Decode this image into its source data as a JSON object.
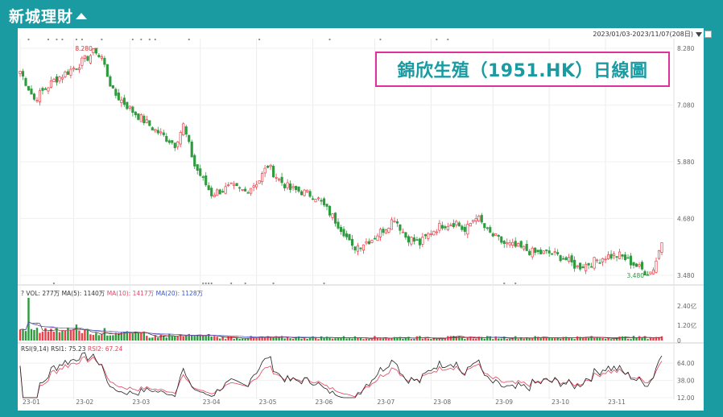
{
  "brand": {
    "name": "新城理財"
  },
  "header": {
    "date_range": "2023/01/03-2023/11/07(208日)"
  },
  "title": "錦欣生殖（1951.HK）日線圖",
  "colors": {
    "up": "#e8424b",
    "down": "#2e9b3f",
    "ma5": "#333333",
    "ma10": "#e04a6a",
    "ma20": "#3a55c8",
    "rsi1": "#222222",
    "rsi2": "#e6405a",
    "accent": "#1a9aa1",
    "title_border": "#e0309a"
  },
  "chart_data": [
    {
      "type": "candlestick",
      "name": "price",
      "x_tick_labels": [
        "23-01",
        "23-02",
        "23-03",
        "23-04",
        "23-05",
        "23-06",
        "23-07",
        "23-08",
        "23-09",
        "23-10",
        "23-11"
      ],
      "y_tick_labels": [
        "8.280",
        "7.080",
        "5.880",
        "4.680",
        "3.480"
      ],
      "ylim": [
        3.48,
        8.28
      ],
      "annotations": [
        {
          "text": "8.280",
          "kind": "high"
        },
        {
          "text": "3.480",
          "kind": "low"
        }
      ],
      "close_path": [
        [
          0,
          7.8
        ],
        [
          5,
          7.2
        ],
        [
          12,
          7.6
        ],
        [
          20,
          7.9
        ],
        [
          28,
          8.28
        ],
        [
          33,
          7.35
        ],
        [
          40,
          6.95
        ],
        [
          48,
          6.55
        ],
        [
          55,
          6.25
        ],
        [
          58,
          6.65
        ],
        [
          62,
          5.8
        ],
        [
          68,
          5.2
        ],
        [
          75,
          5.35
        ],
        [
          80,
          5.25
        ],
        [
          85,
          5.5
        ],
        [
          88,
          5.8
        ],
        [
          92,
          5.5
        ],
        [
          96,
          5.3
        ],
        [
          100,
          5.25
        ],
        [
          105,
          5.15
        ],
        [
          110,
          4.8
        ],
        [
          115,
          4.4
        ],
        [
          118,
          4.05
        ],
        [
          125,
          4.25
        ],
        [
          130,
          4.5
        ],
        [
          133,
          4.7
        ],
        [
          137,
          4.3
        ],
        [
          142,
          4.15
        ],
        [
          146,
          4.4
        ],
        [
          150,
          4.55
        ],
        [
          155,
          4.6
        ],
        [
          158,
          4.4
        ],
        [
          162,
          4.75
        ],
        [
          166,
          4.4
        ],
        [
          172,
          4.15
        ],
        [
          178,
          4.05
        ],
        [
          183,
          3.95
        ],
        [
          188,
          3.95
        ],
        [
          193,
          3.85
        ],
        [
          198,
          3.65
        ],
        [
          203,
          3.75
        ],
        [
          208,
          3.88
        ],
        [
          213,
          3.9
        ],
        [
          218,
          3.72
        ],
        [
          221,
          3.6
        ],
        [
          224,
          3.48
        ],
        [
          226,
          3.8
        ],
        [
          228,
          4.2
        ]
      ]
    },
    {
      "type": "bar",
      "name": "volume",
      "legend": {
        "prefix": "?",
        "vol": "VOL: 277万",
        "ma5": "MA(5): 1140万",
        "ma10": "MA(10): 1417万",
        "ma20": "MA(20): 1128万"
      },
      "y_tick_labels": [
        "2.40亿",
        "1.20亿",
        "0"
      ],
      "peak_label": "2.40亿"
    },
    {
      "type": "line",
      "name": "rsi",
      "legend": {
        "title": "RSI(9,14)",
        "rsi1": "RSI1: 75.23",
        "rsi2": "RSI2: 67.24"
      },
      "y_tick_labels": [
        "64.00",
        "38.00",
        "12.00"
      ],
      "ylim": [
        12,
        80
      ],
      "last_values": {
        "rsi1": 75.23,
        "rsi2": 67.24
      }
    }
  ]
}
